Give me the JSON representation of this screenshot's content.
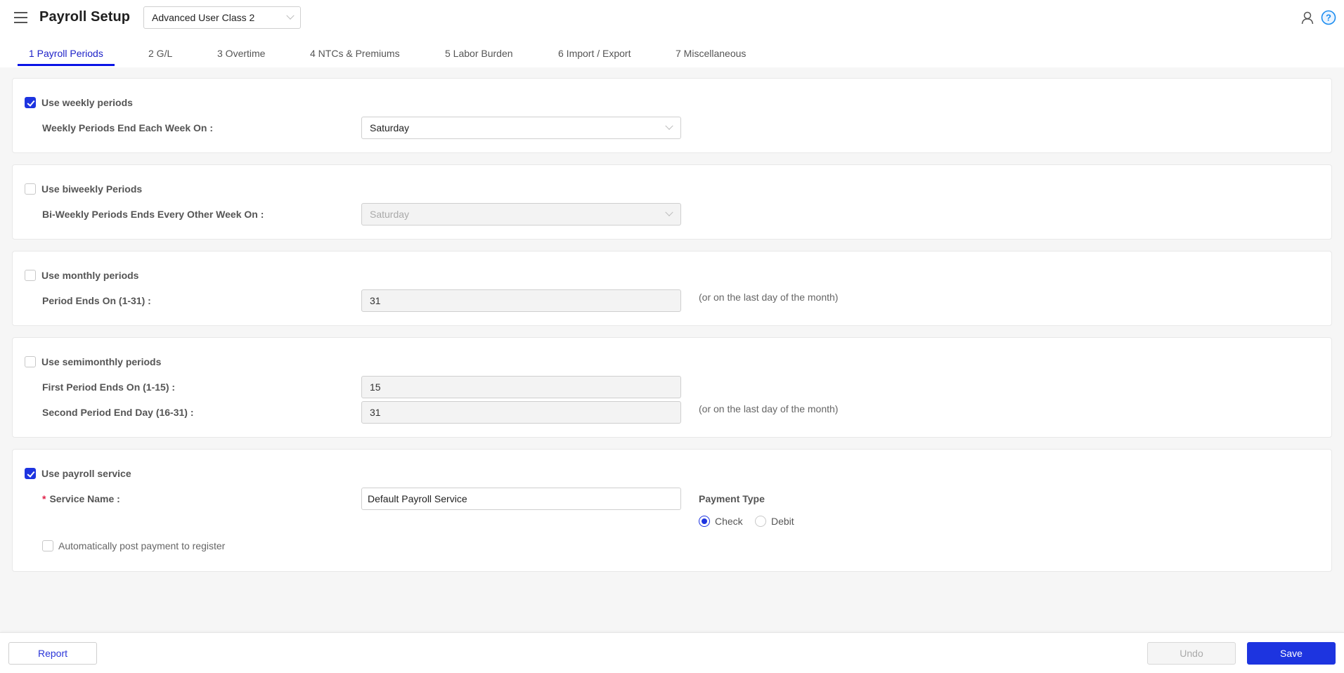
{
  "header": {
    "title": "Payroll Setup",
    "class_select": "Advanced User Class 2",
    "icons": {
      "menu": "hamburger-icon",
      "user": "user-icon",
      "help": "help-icon"
    }
  },
  "tabs": [
    {
      "label": "1 Payroll Periods",
      "active": true
    },
    {
      "label": "2 G/L"
    },
    {
      "label": "3 Overtime"
    },
    {
      "label": "4 NTCs & Premiums"
    },
    {
      "label": "5 Labor Burden"
    },
    {
      "label": "6 Import / Export"
    },
    {
      "label": "7 Miscellaneous"
    }
  ],
  "weekly": {
    "checkbox_label": "Use weekly periods",
    "checked": true,
    "field_label": "Weekly Periods End Each Week On :",
    "value": "Saturday"
  },
  "biweekly": {
    "checkbox_label": "Use biweekly Periods",
    "checked": false,
    "field_label": "Bi-Weekly Periods Ends Every Other Week On :",
    "value": "Saturday"
  },
  "monthly": {
    "checkbox_label": "Use monthly periods",
    "checked": false,
    "field_label": "Period Ends On (1-31) :",
    "value": "31",
    "note": "(or on the last day of the month)"
  },
  "semimonthly": {
    "checkbox_label": "Use semimonthly periods",
    "checked": false,
    "first_label": "First Period Ends On (1-15) :",
    "first_value": "15",
    "second_label": "Second Period End Day (16-31) :",
    "second_value": "31",
    "note": "(or on the last day of the month)"
  },
  "payroll_service": {
    "checkbox_label": "Use payroll service",
    "checked": true,
    "required_mark": "*",
    "service_label": "Service Name :",
    "service_value": "Default Payroll Service",
    "payment_type_label": "Payment Type",
    "payment_options": [
      {
        "label": "Check",
        "selected": true
      },
      {
        "label": "Debit",
        "selected": false
      }
    ],
    "auto_post_label": "Automatically post payment to register",
    "auto_post_checked": false
  },
  "footer": {
    "report": "Report",
    "undo": "Undo",
    "save": "Save"
  },
  "colors": {
    "accent": "#1d34e0",
    "tab_active": "#1e22c8",
    "required": "#e0234a"
  }
}
